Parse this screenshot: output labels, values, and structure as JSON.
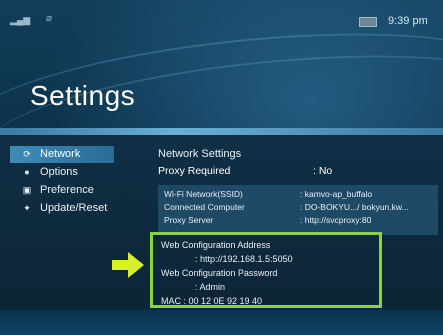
{
  "status": {
    "time": "9:39 pm",
    "icons": [
      "signal-icon",
      "wifi-icon",
      "battery-icon"
    ]
  },
  "page": {
    "title": "Settings"
  },
  "sidebar": {
    "items": [
      {
        "label": "Network",
        "icon": "network-icon",
        "active": true
      },
      {
        "label": "Options",
        "icon": "options-icon",
        "active": false
      },
      {
        "label": "Preference",
        "icon": "preference-icon",
        "active": false
      },
      {
        "label": "Update/Reset",
        "icon": "update-icon",
        "active": false
      }
    ]
  },
  "network": {
    "title": "Network Settings",
    "proxy_required": {
      "label": "Proxy Required",
      "value": ": No"
    },
    "info": [
      {
        "label": "Wi-Fi Network(SSID)",
        "value": ": kamvo-ap_buffalo"
      },
      {
        "label": "Connected Computer",
        "value": ": DO-BOKYU.../ bokyun.kw..."
      },
      {
        "label": "Proxy Server",
        "value": ": http://svcproxy:80"
      }
    ],
    "web_config": {
      "address_label": "Web Configuration Address",
      "address_value": ": http://192.168.1.5:5050",
      "password_label": "Web Configuration Password",
      "password_value": ": Admin",
      "mac": "MAC : 00 12 0E 92 19 40"
    }
  },
  "colors": {
    "highlight": "#8cd43a",
    "accent": "#3e8bb8",
    "arrow": "#d8f02a"
  }
}
